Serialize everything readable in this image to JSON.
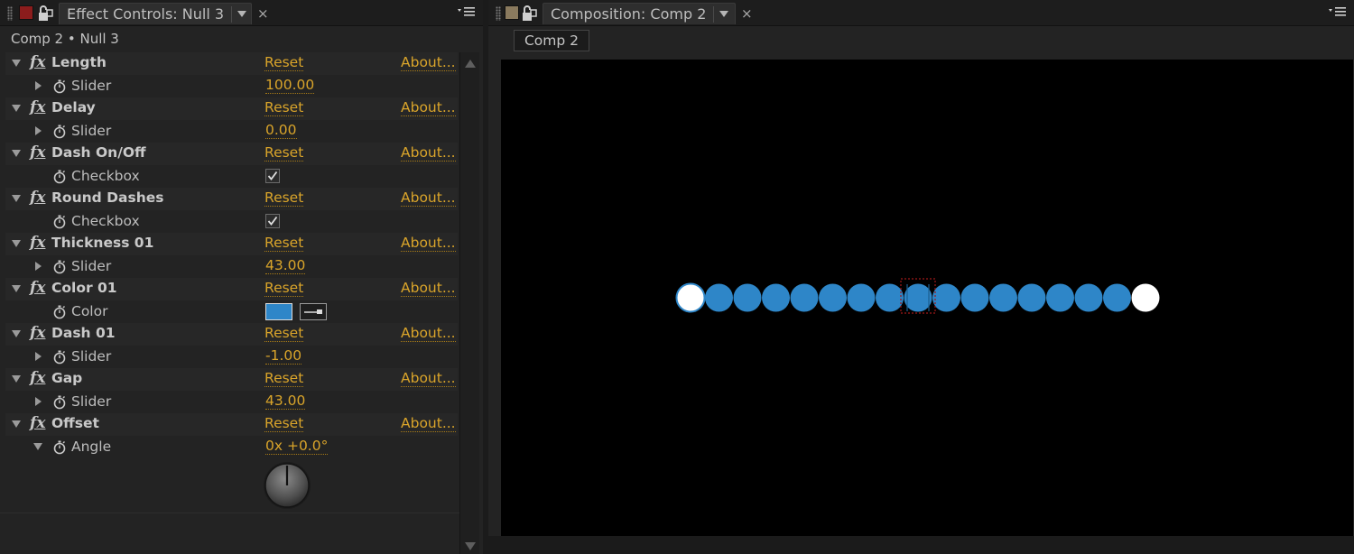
{
  "colors": {
    "accent_link": "#d9a42a",
    "dash_blue": "#2e86c8",
    "endpoint_white": "#ffffff",
    "layer_label_red": "#8b1c1c",
    "comp_label_tan": "#8a7a5e"
  },
  "effect_controls": {
    "tab_title": "Effect Controls: Null 3",
    "breadcrumb": "Comp 2 • Null 3",
    "reset_label": "Reset",
    "about_label": "About...",
    "effects": [
      {
        "name": "Length",
        "param": "Slider",
        "value": "100.00"
      },
      {
        "name": "Delay",
        "param": "Slider",
        "value": "0.00"
      },
      {
        "name": "Dash On/Off",
        "param": "Checkbox",
        "checked": true
      },
      {
        "name": "Round Dashes",
        "param": "Checkbox",
        "checked": true
      },
      {
        "name": "Thickness 01",
        "param": "Slider",
        "value": "43.00"
      },
      {
        "name": "Color 01",
        "param": "Color",
        "color": "#2e86c8"
      },
      {
        "name": "Dash 01",
        "param": "Slider",
        "value": "-1.00"
      },
      {
        "name": "Gap",
        "param": "Slider",
        "value": "43.00"
      },
      {
        "name": "Offset",
        "param": "Angle",
        "value": "0x +0.0°"
      }
    ]
  },
  "composition": {
    "tab_title": "Composition: Comp 2",
    "comp_button": "Comp 2",
    "dash_count": 17
  }
}
